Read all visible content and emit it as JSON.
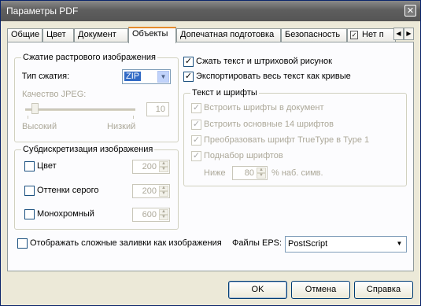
{
  "window": {
    "title": "Параметры PDF",
    "close_glyph": "✕"
  },
  "tabs": [
    {
      "label": "Общие"
    },
    {
      "label": "Цвет"
    },
    {
      "label": "Документ"
    },
    {
      "label": "Объекты",
      "active": true
    },
    {
      "label": "Допечатная подготовка"
    },
    {
      "label": "Безопасность"
    },
    {
      "label": "Нет п"
    }
  ],
  "tab_scroll": {
    "left": "◀",
    "right": "▶"
  },
  "raster": {
    "legend": "Сжатие растрового изображения",
    "compression_label": "Тип сжатия:",
    "compression_value": "ZIP",
    "jpeg_quality_label": "Качество JPEG:",
    "jpeg_quality_value": "10",
    "slider_high": "Высокий",
    "slider_low": "Низкий"
  },
  "downsample": {
    "legend": "Субдискретизация изображения",
    "rows": [
      {
        "label": "Цвет",
        "value": "200",
        "checked": false
      },
      {
        "label": "Оттенки серого",
        "value": "200",
        "checked": false
      },
      {
        "label": "Монохромный",
        "value": "600",
        "checked": false
      }
    ]
  },
  "right": {
    "compress_text": {
      "label": "Сжать текст и штриховой рисунок",
      "checked": true
    },
    "export_curves": {
      "label": "Экспортировать весь текст как кривые",
      "checked": true
    }
  },
  "fonts": {
    "legend": "Текст и шрифты",
    "embed": "Встроить шрифты в документ",
    "embed_base14": "Встроить основные 14 шрифтов",
    "truetype": "Преобразовать шрифт TrueType в Type 1",
    "subset": "Поднабор шрифтов",
    "below_label": "Ниже",
    "below_value": "80",
    "below_suffix": "% наб. симв."
  },
  "complex_fills": {
    "label": "Отображать сложные заливки как изображения",
    "checked": false
  },
  "eps": {
    "label": "Файлы EPS:",
    "value": "PostScript"
  },
  "buttons": {
    "ok": "OK",
    "cancel": "Отмена",
    "help": "Справка"
  },
  "check_glyph": "✓",
  "arrow_down": "▼",
  "spin_up": "▲",
  "spin_down": "▼"
}
